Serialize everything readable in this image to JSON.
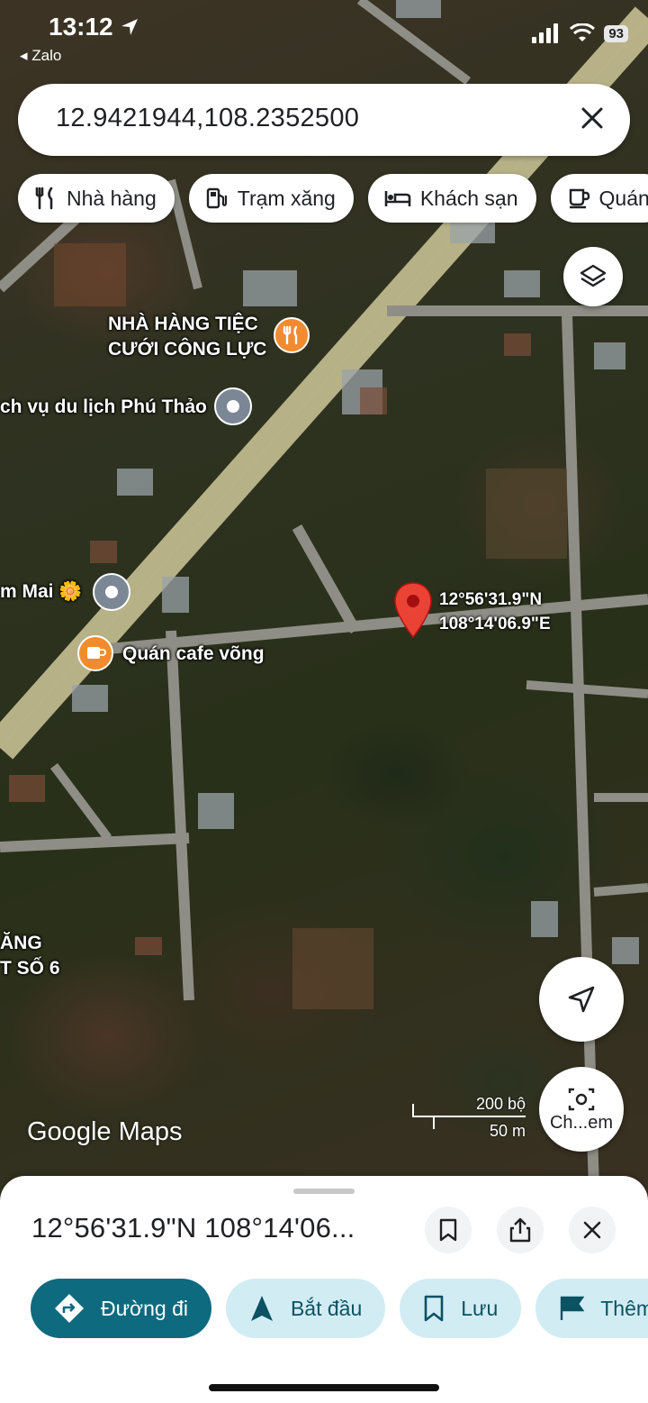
{
  "status": {
    "time": "13:12",
    "back_app": "◂ Zalo",
    "battery": "93"
  },
  "search": {
    "value": "12.9421944,108.2352500"
  },
  "chips": [
    {
      "label": "Nhà hàng",
      "icon": "restaurant-icon"
    },
    {
      "label": "Trạm xăng",
      "icon": "gas-station-icon"
    },
    {
      "label": "Khách sạn",
      "icon": "hotel-icon"
    },
    {
      "label": "Quán",
      "icon": "cafe-icon"
    }
  ],
  "map": {
    "pois": [
      {
        "label_line1": "NHÀ HÀNG TIỆC",
        "label_line2": "CƯỚI CÔNG LỰC"
      },
      {
        "label": "ch vụ du lịch Phú Thảo"
      },
      {
        "label": "m Mai 🌼"
      },
      {
        "label": "Quán cafe võng"
      },
      {
        "label_line1": "ĂNG",
        "label_line2": "T SỐ 6"
      }
    ],
    "pin_coords": {
      "lat": "12°56'31.9\"N",
      "lng": "108°14'06.9\"E"
    },
    "scale": {
      "imperial": "200 bộ",
      "metric": "50 m"
    },
    "logo": "Google Maps",
    "camera_label": "Ch...em"
  },
  "sheet": {
    "title": "12°56'31.9\"N 108°14'06...",
    "actions": [
      {
        "label": "Đường đi"
      },
      {
        "label": "Bắt đầu"
      },
      {
        "label": "Lưu"
      },
      {
        "label": "Thêm"
      }
    ]
  },
  "colors": {
    "primary": "#0e6a7f",
    "chip_bg": "#d2ecf3",
    "pin": "#ea4335",
    "poi_orange": "#f28b30"
  }
}
